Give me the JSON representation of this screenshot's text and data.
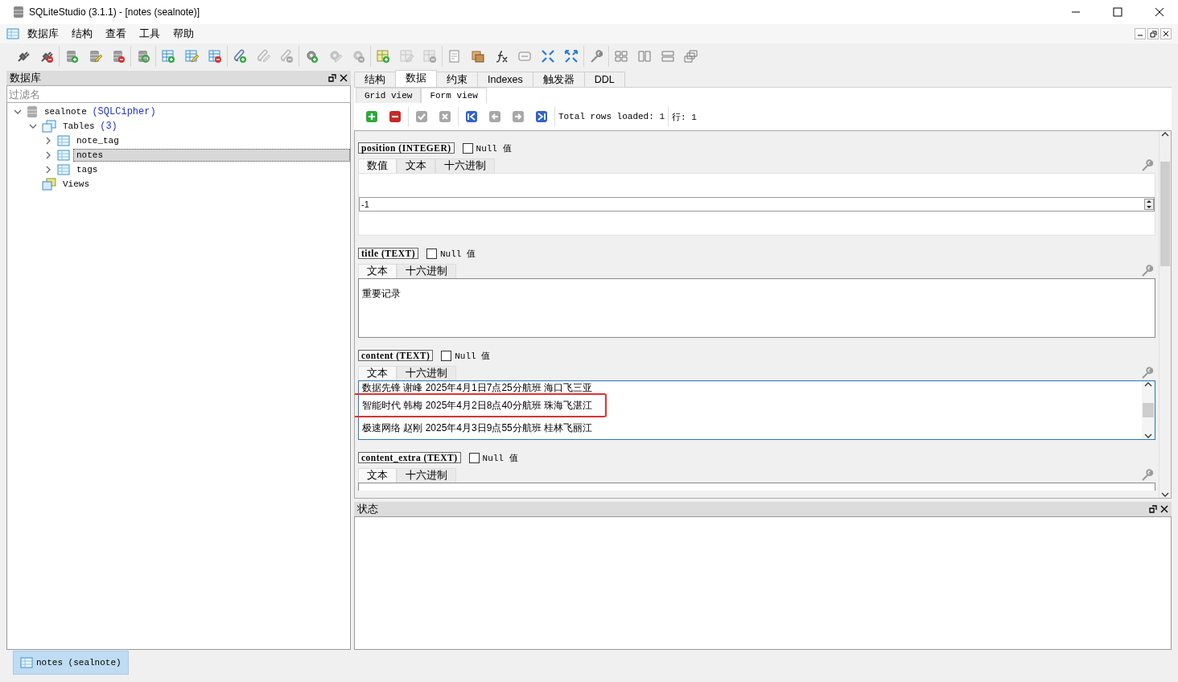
{
  "window": {
    "title": "SQLiteStudio (3.1.1) - [notes (sealnote)]"
  },
  "menu": [
    "数据库",
    "结构",
    "查看",
    "工具",
    "帮助"
  ],
  "toolbar": [
    [
      {
        "kind": "plug",
        "disabled": false
      },
      {
        "kind": "plug-remove",
        "disabled": false
      }
    ],
    [
      {
        "kind": "db-add",
        "disabled": false
      },
      {
        "kind": "db-edit",
        "disabled": false
      },
      {
        "kind": "db-remove",
        "disabled": false
      }
    ],
    [
      {
        "kind": "db-refresh",
        "disabled": false
      }
    ],
    [
      {
        "kind": "table-add",
        "disabled": false
      },
      {
        "kind": "table-edit",
        "disabled": false
      },
      {
        "kind": "table-remove",
        "disabled": false
      }
    ],
    [
      {
        "kind": "index-add",
        "disabled": false
      },
      {
        "kind": "index-edit",
        "disabled": true
      },
      {
        "kind": "index-remove",
        "disabled": true
      }
    ],
    [
      {
        "kind": "trigger-add",
        "disabled": false
      },
      {
        "kind": "trigger-edit",
        "disabled": true
      },
      {
        "kind": "trigger-remove",
        "disabled": true
      }
    ],
    [
      {
        "kind": "view-add",
        "disabled": false
      },
      {
        "kind": "view-edit",
        "disabled": true
      },
      {
        "kind": "view-remove",
        "disabled": true
      }
    ],
    [
      {
        "kind": "sql",
        "disabled": false
      },
      {
        "kind": "import",
        "disabled": false
      },
      {
        "kind": "function",
        "disabled": false
      },
      {
        "kind": "collation",
        "disabled": false
      },
      {
        "kind": "collapse",
        "disabled": false
      },
      {
        "kind": "expand",
        "disabled": false
      }
    ],
    [
      {
        "kind": "config",
        "disabled": false
      }
    ],
    [
      {
        "kind": "tile",
        "disabled": false
      },
      {
        "kind": "tile-h",
        "disabled": false
      },
      {
        "kind": "tile-v",
        "disabled": false
      },
      {
        "kind": "cascade",
        "disabled": false
      }
    ]
  ],
  "db_panel": {
    "title": "数据库",
    "filter": {
      "placeholder": "过滤名"
    },
    "tree": [
      {
        "label": "sealnote",
        "note": "(SQLCipher)",
        "kind": "database",
        "expanded": true,
        "selected": false,
        "children": [
          {
            "label": "Tables",
            "note": "(3)",
            "kind": "tables",
            "expanded": true,
            "selected": false,
            "children": [
              {
                "label": "note_tag",
                "kind": "table",
                "expanded": false,
                "selected": false
              },
              {
                "label": "notes",
                "kind": "table",
                "expanded": false,
                "selected": true
              },
              {
                "label": "tags",
                "kind": "table",
                "expanded": false,
                "selected": false
              }
            ]
          },
          {
            "label": "Views",
            "kind": "views",
            "selected": false
          }
        ]
      }
    ]
  },
  "tabs": [
    {
      "label": "结构",
      "selected": false
    },
    {
      "label": "数据",
      "selected": true
    },
    {
      "label": "约束",
      "selected": false
    },
    {
      "label": "Indexes",
      "selected": false
    },
    {
      "label": "触发器",
      "selected": false
    },
    {
      "label": "DDL",
      "selected": false
    }
  ],
  "subtabs": [
    {
      "label": "Grid view",
      "selected": false
    },
    {
      "label": "Form view",
      "selected": true
    }
  ],
  "form_toolbar": {
    "buttons": [
      [
        {
          "kind": "add",
          "disabled": false
        },
        {
          "kind": "remove",
          "disabled": false
        }
      ],
      [
        {
          "kind": "commit",
          "disabled": true
        },
        {
          "kind": "rollback",
          "disabled": true
        }
      ],
      [
        {
          "kind": "first",
          "disabled": false
        },
        {
          "kind": "prev",
          "disabled": true
        },
        {
          "kind": "next",
          "disabled": true
        },
        {
          "kind": "last",
          "disabled": false
        }
      ]
    ],
    "total": "Total rows loaded: 1",
    "row": "行: 1"
  },
  "fields": [
    {
      "name": "position (INTEGER)",
      "kind": "spin",
      "null_label": "Null 值",
      "null_checked": false,
      "tabs": [
        {
          "label": "数值",
          "selected": true
        },
        {
          "label": "文本",
          "selected": false
        },
        {
          "label": "十六进制",
          "selected": false
        }
      ],
      "value": "-1"
    },
    {
      "name": "title (TEXT)",
      "kind": "text",
      "null_label": "Null 值",
      "null_checked": false,
      "tabs": [
        {
          "label": "文本",
          "selected": true
        },
        {
          "label": "十六进制",
          "selected": false
        }
      ],
      "lines": [
        {
          "text": "重要记录",
          "highlighted": false
        }
      ]
    },
    {
      "name": "content (TEXT)",
      "kind": "text",
      "focused": true,
      "null_label": "Null 值",
      "null_checked": false,
      "tabs": [
        {
          "label": "文本",
          "selected": true
        },
        {
          "label": "十六进制",
          "selected": false
        }
      ],
      "lines": [
        {
          "text": "数据先锋 谢峰 2025年4月1日7点25分航班 海口飞三亚",
          "highlighted": false
        },
        {
          "text": "智能时代 韩梅 2025年4月2日8点40分航班 珠海飞湛江",
          "highlighted": true
        },
        {
          "text": "极速网络 赵刚 2025年4月3日9点55分航班 桂林飞丽江",
          "highlighted": false
        }
      ]
    },
    {
      "name": "content_extra (TEXT)",
      "kind": "text",
      "null_label": "Null 值",
      "null_checked": false,
      "tabs": [
        {
          "label": "文本",
          "selected": true
        },
        {
          "label": "十六进制",
          "selected": false
        }
      ]
    }
  ],
  "status_panel": {
    "title": "状态"
  },
  "taskbar": [
    {
      "label": "notes (sealnote)",
      "selected": true
    }
  ]
}
